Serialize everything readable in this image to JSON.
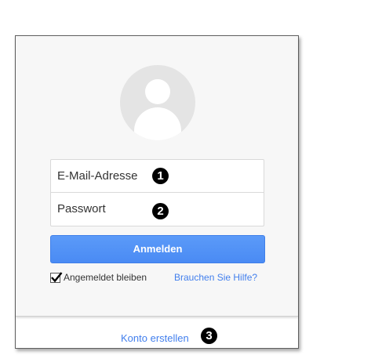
{
  "login": {
    "email_placeholder": "E-Mail-Adresse",
    "password_placeholder": "Passwort",
    "signin_label": "Anmelden",
    "stay_signed_in_label": "Angemeldet bleiben",
    "stay_signed_in_checked": true,
    "help_link": "Brauchen Sie Hilfe?",
    "create_account_link": "Konto erstellen"
  },
  "markers": {
    "one": "1",
    "two": "2",
    "three": "3"
  },
  "colors": {
    "accent": "#4d90fe",
    "link": "#427fed",
    "card_bg": "#f7f7f7",
    "avatar_bg": "#e4e4e4"
  },
  "icons": {
    "avatar": "user-silhouette-icon",
    "checkbox": "checkmark-icon"
  }
}
